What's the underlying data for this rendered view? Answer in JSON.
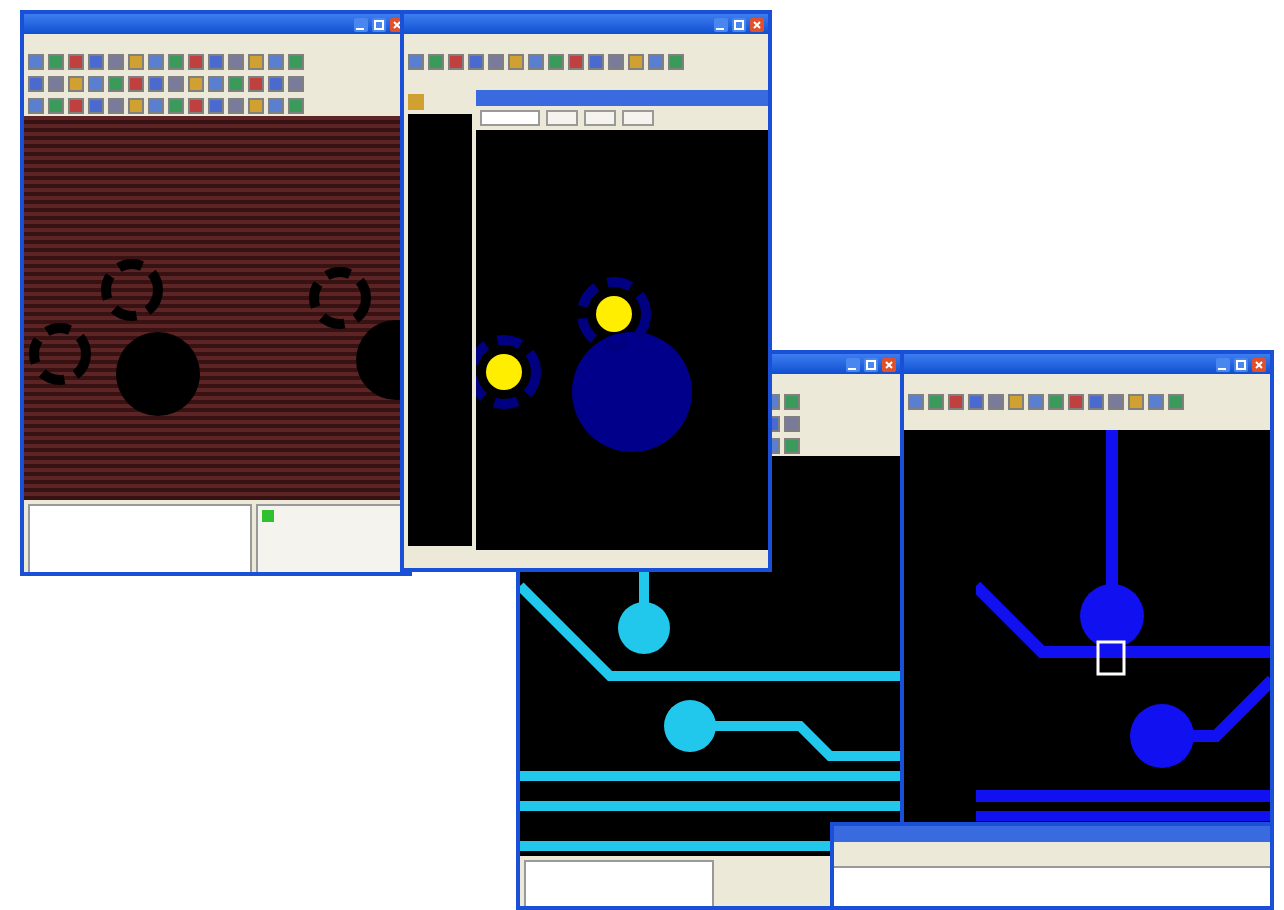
{
  "windows": [
    {
      "kind": "pcb-editor"
    },
    {
      "kind": "pad-viewer"
    },
    {
      "kind": "trace-editor"
    },
    {
      "kind": "trace-viewer"
    },
    {
      "kind": "report-dialog"
    }
  ]
}
